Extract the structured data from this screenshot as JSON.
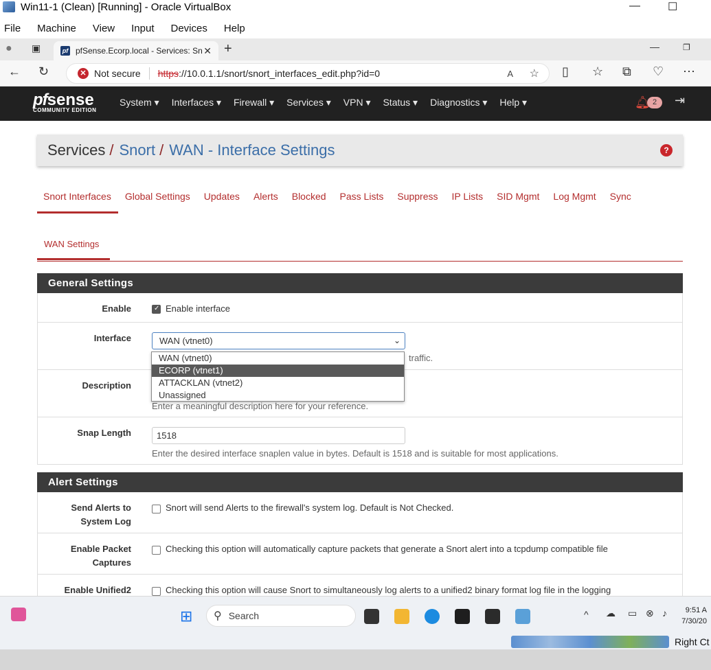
{
  "vbox": {
    "title": "Win11-1 (Clean) [Running] - Oracle VirtualBox",
    "menu": [
      "File",
      "Machine",
      "View",
      "Input",
      "Devices",
      "Help"
    ],
    "status_right": "Right Ct"
  },
  "browser": {
    "tab_title": "pfSense.Ecorp.local - Services: Sn",
    "not_secure": "Not secure",
    "url_scheme": "https",
    "url_rest": "://10.0.1.1/snort/snort_interfaces_edit.php?id=0"
  },
  "pfsense": {
    "logo_pf": "pf",
    "logo_sense": "sense",
    "logo_sub": "COMMUNITY EDITION",
    "nav": [
      "System ▾",
      "Interfaces ▾",
      "Firewall ▾",
      "Services ▾",
      "VPN ▾",
      "Status ▾",
      "Diagnostics ▾",
      "Help ▾"
    ],
    "notif_count": "2"
  },
  "breadcrumb": {
    "root": "Services",
    "mid": "Snort",
    "current": "WAN - Interface Settings",
    "help": "?"
  },
  "tabs": [
    "Snort Interfaces",
    "Global Settings",
    "Updates",
    "Alerts",
    "Blocked",
    "Pass Lists",
    "Suppress",
    "IP Lists",
    "SID Mgmt",
    "Log Mgmt",
    "Sync"
  ],
  "subtab": "WAN Settings",
  "general": {
    "header": "General Settings",
    "enable_label": "Enable",
    "enable_text": "Enable interface",
    "interface_label": "Interface",
    "interface_value": "WAN (vtnet0)",
    "interface_hint_tail": "traffic.",
    "interface_options": [
      "WAN (vtnet0)",
      "ECORP (vtnet1)",
      "ATTACKLAN (vtnet2)",
      "Unassigned"
    ],
    "description_label": "Description",
    "description_hint": "Enter a meaningful description here for your reference.",
    "snaplen_label": "Snap Length",
    "snaplen_value": "1518",
    "snaplen_hint": "Enter the desired interface snaplen value in bytes. Default is 1518 and is suitable for most applications."
  },
  "alert": {
    "header": "Alert Settings",
    "send_label_1": "Send Alerts to",
    "send_label_2": "System Log",
    "send_text": "Snort will send Alerts to the firewall's system log. Default is Not Checked.",
    "packet_label_1": "Enable Packet",
    "packet_label_2": "Captures",
    "packet_text": "Checking this option will automatically capture packets that generate a Snort alert into a tcpdump compatible file",
    "unified_label": "Enable Unified2",
    "unified_text": "Checking this option will cause Snort to simultaneously log alerts to a unified2 binary format log file in the logging"
  },
  "taskbar": {
    "search": "Search",
    "time": "9:51 A",
    "date": "7/30/20"
  }
}
